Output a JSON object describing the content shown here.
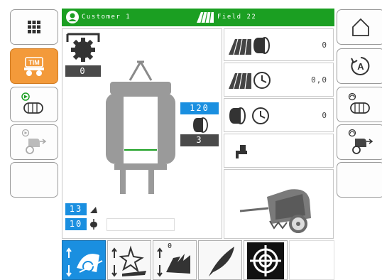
{
  "header": {
    "customer": "Customer 1",
    "field": "Field 22"
  },
  "left_sidebar": {
    "items": [
      {
        "icon": "grid-menu-icon"
      },
      {
        "icon": "tim-tractor-icon",
        "label": "TIM",
        "active": true
      },
      {
        "icon": "bale-auto-icon"
      },
      {
        "icon": "baler-eject-icon"
      },
      {
        "icon": "empty"
      }
    ]
  },
  "right_sidebar": {
    "items": [
      {
        "icon": "home-icon"
      },
      {
        "icon": "auto-mode-icon",
        "label": "A"
      },
      {
        "icon": "bale-settings-icon"
      },
      {
        "icon": "baler-settings-icon"
      },
      {
        "icon": "empty"
      }
    ]
  },
  "machine": {
    "rotor_value": "0",
    "pressure_target": "120",
    "bale_count": "3",
    "tilt_value": "13",
    "knife_value": "10"
  },
  "counters": {
    "field_bales": "0",
    "field_time": "0,0",
    "bale_time": "0"
  },
  "bottom_bar": {
    "items": [
      {
        "icon": "pickup-icon",
        "active": true
      },
      {
        "icon": "knife-icon"
      },
      {
        "icon": "rotor-icon",
        "value": "0"
      },
      {
        "icon": "feather-icon"
      },
      {
        "icon": "target-icon"
      }
    ]
  },
  "colors": {
    "header_green": "#1b9f22",
    "accent_blue": "#1a8fe0",
    "active_orange": "#f39a3a",
    "dark_label": "#4a4a4a"
  }
}
